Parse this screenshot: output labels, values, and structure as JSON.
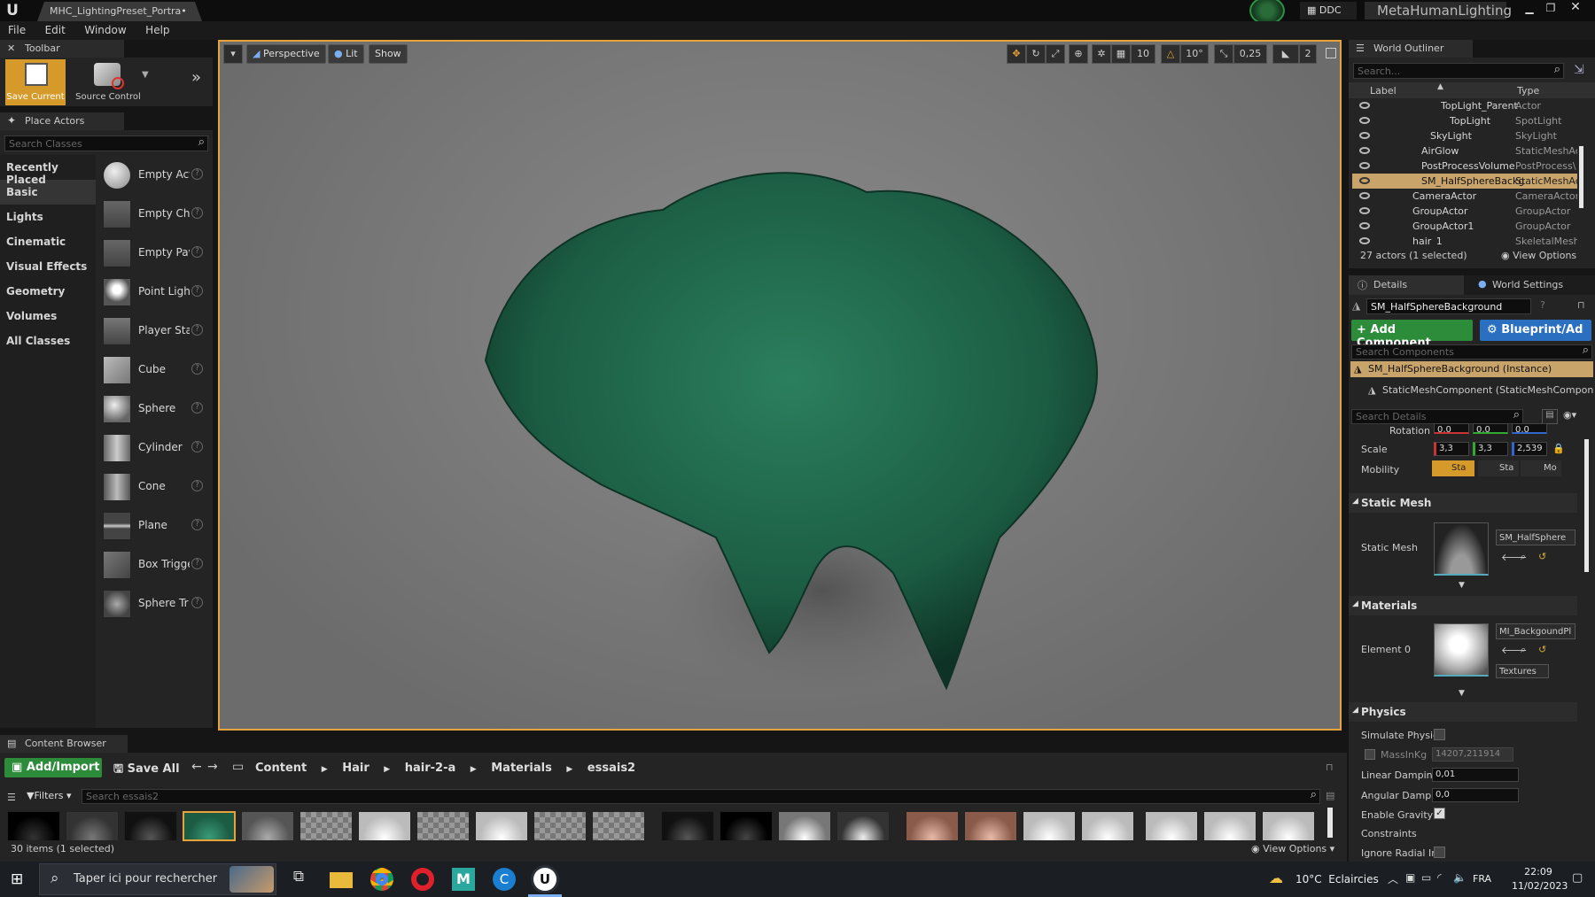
{
  "window": {
    "tab_title": "MHC_LightingPreset_Portra•",
    "ddc_label": "DDC",
    "project_name": "MetaHumanLighting"
  },
  "menu": [
    "File",
    "Edit",
    "Window",
    "Help"
  ],
  "toolbar": {
    "panel_title": "Toolbar",
    "save_label": "Save Current",
    "source_label": "Source Control"
  },
  "place_actors": {
    "panel_title": "Place Actors",
    "search_placeholder": "Search Classes",
    "categories": [
      "Recently Placed",
      "Basic",
      "Lights",
      "Cinematic",
      "Visual Effects",
      "Geometry",
      "Volumes",
      "All Classes"
    ],
    "active_category": "Basic",
    "items": [
      "Empty Act",
      "Empty Cha",
      "Empty Pav",
      "Point Light",
      "Player Sta",
      "Cube",
      "Sphere",
      "Cylinder",
      "Cone",
      "Plane",
      "Box Trigge",
      "Sphere Tr"
    ]
  },
  "viewport": {
    "perspective": "Perspective",
    "lit": "Lit",
    "show": "Show",
    "grid": "10",
    "angle": "10°",
    "scale": "0,25",
    "camera_speed": "2",
    "colors": {
      "hair": "#1e6a4e",
      "background": "#7d7d7d",
      "selection": "#e6a33a"
    }
  },
  "outliner": {
    "panel_title": "World Outliner",
    "search_placeholder": "Search...",
    "col_label": "Label",
    "col_type": "Type",
    "rows": [
      {
        "label": "TopLight_Parent",
        "type": "Actor",
        "indent": 2
      },
      {
        "label": "TopLight",
        "type": "SpotLight",
        "indent": 3
      },
      {
        "label": "SkyLight",
        "type": "SkyLight",
        "indent": 2
      },
      {
        "label": "AirGlow",
        "type": "StaticMeshAc",
        "indent": 1
      },
      {
        "label": "PostProcessVolume",
        "type": "PostProcess\\",
        "indent": 1
      },
      {
        "label": "SM_HalfSphereBackg",
        "type": "StaticMeshAc",
        "indent": 1,
        "selected": true
      },
      {
        "label": "CameraActor",
        "type": "CameraActor",
        "indent": 0
      },
      {
        "label": "GroupActor",
        "type": "GroupActor",
        "indent": 0
      },
      {
        "label": "GroupActor1",
        "type": "GroupActor",
        "indent": 0
      },
      {
        "label": "hair_1",
        "type": "SkeletalMesh",
        "indent": 0
      }
    ],
    "status": "27 actors (1 selected)",
    "view_options": "View Options"
  },
  "details": {
    "tab_details": "Details",
    "tab_world": "World Settings",
    "actor_name": "SM_HalfSphereBackground",
    "add_component": "+ Add Component",
    "blueprint": "Blueprint/Ad",
    "search_components": "Search Components",
    "instance_label": "SM_HalfSphereBackground (Instance)",
    "component_label": "StaticMeshComponent (StaticMeshComponent",
    "search_details": "Search Details",
    "rotation_label": "Rotation",
    "rotation": [
      "0,0",
      "0,0",
      "0,0"
    ],
    "scale_label": "Scale",
    "scale": [
      "3,3",
      "3,3",
      "2,539"
    ],
    "mobility_label": "Mobility",
    "mobility": [
      "Sta",
      "Sta",
      "Mo"
    ],
    "static_mesh_section": "Static Mesh",
    "static_mesh_label": "Static Mesh",
    "static_mesh_value": "SM_HalfSphere",
    "materials_section": "Materials",
    "element_label": "Element 0",
    "material_value": "MI_BackgoundPl",
    "textures": "Textures",
    "physics_section": "Physics",
    "simulate": "Simulate Physic",
    "mass_label": "MassInKg",
    "mass_value": "14207,211914",
    "linear_label": "Linear Damping",
    "linear_value": "0,01",
    "angular_label": "Angular Dampin",
    "angular_value": "0,0",
    "gravity_label": "Enable Gravity",
    "constraints": "Constraints",
    "ignore_radial": "Ignore Radial Im"
  },
  "content_browser": {
    "panel_title": "Content Browser",
    "add_import": "Add/Import",
    "save_all": "Save All",
    "path": [
      "Content",
      "Hair",
      "hair-2-a",
      "Materials",
      "essais2"
    ],
    "filters": "Filters",
    "search_placeholder": "Search essais2",
    "status": "30 items (1 selected)",
    "view_options": "View Options"
  },
  "taskbar": {
    "search_placeholder": "Taper ici pour rechercher",
    "weather": "10°C  Eclaircies",
    "lang": "FRA",
    "time": "22:09",
    "date": "11/02/2023"
  }
}
